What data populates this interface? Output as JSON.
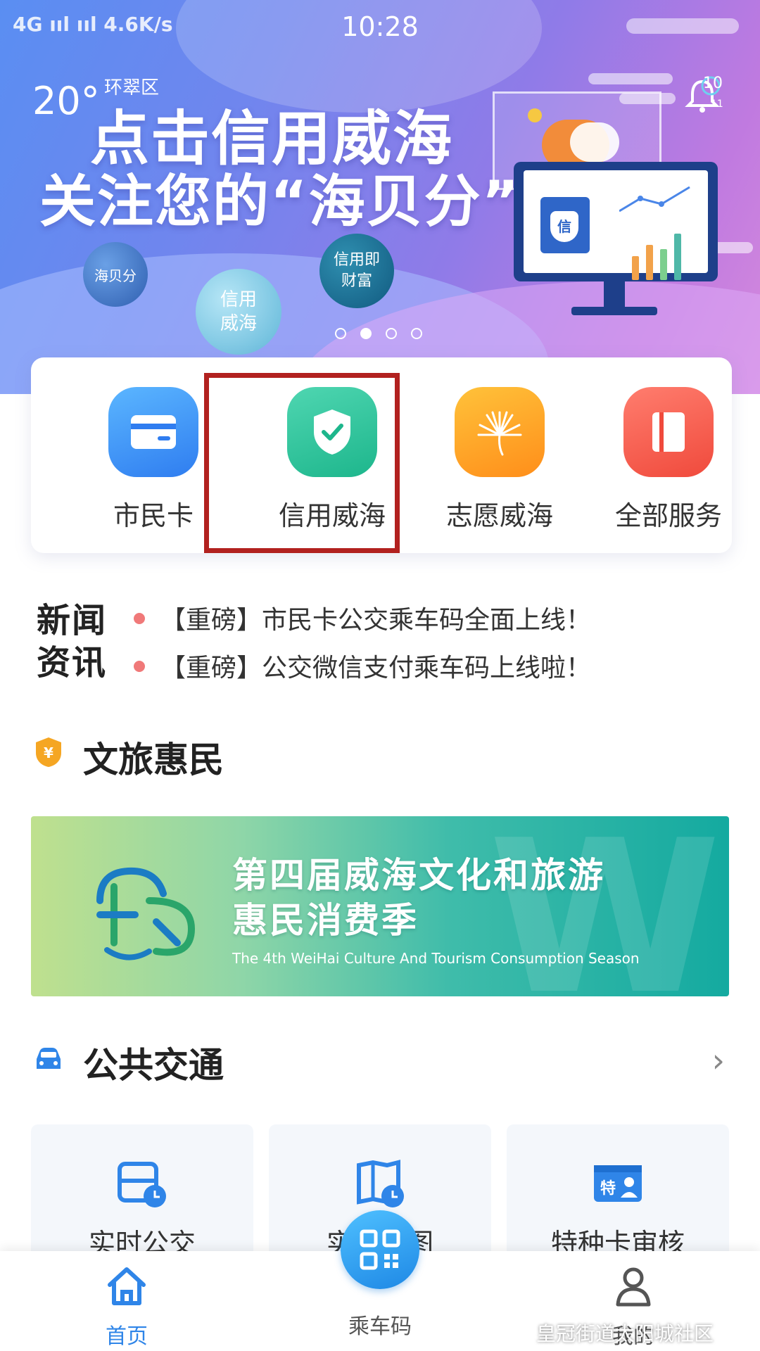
{
  "status_bar": {
    "signal": "4G ııl ııl",
    "speed": "4.6K/s",
    "time": "10:28"
  },
  "weather": {
    "temp": "20°",
    "area": "环翠区"
  },
  "notification": {
    "count": "10",
    "sub": "11"
  },
  "banner": {
    "headline_1": "点击信用威海",
    "headline_2": "关注您的“海贝分”",
    "bubble_1": "海贝分",
    "bubble_2_line1": "信用",
    "bubble_2_line2": "威海",
    "bubble_3_line1": "信用即",
    "bubble_3_line2": "财富",
    "monitor_badge": "信",
    "page_indicator": {
      "count": 4,
      "active_index": 1
    }
  },
  "services": [
    {
      "label": "市民卡",
      "icon": "card-icon",
      "color": "#2f7df0"
    },
    {
      "label": "信用威海",
      "icon": "shield-check-icon",
      "color": "#1db68c"
    },
    {
      "label": "志愿威海",
      "icon": "palm-leaf-icon",
      "color": "#ff8e1a"
    },
    {
      "label": "全部服务",
      "icon": "book-icon",
      "color": "#f04a3c"
    }
  ],
  "news": {
    "tag": "新闻资讯",
    "items": [
      "【重磅】市民卡公交乘车码全面上线！",
      "【重磅】公交微信支付乘车码上线啦！"
    ]
  },
  "culture_section": {
    "title": "文旅惠民",
    "icon": "yuan-shield-icon",
    "promo_line1": "第四届威海文化和旅游",
    "promo_line2": "惠民消费季",
    "promo_english": "The 4th WeiHai Culture And Tourism Consumption Season"
  },
  "transit_section": {
    "title": "公共交通",
    "icon": "car-icon",
    "cards": [
      {
        "label": "实时公交",
        "icon": "bus-clock-icon"
      },
      {
        "label": "实时地图",
        "icon": "map-clock-icon"
      },
      {
        "label": "特种卡审核",
        "icon": "special-card-icon"
      }
    ]
  },
  "bottom_nav": {
    "home": "首页",
    "ride_code": "乘车码",
    "mine": "我的"
  },
  "watermark": "皇冠街道太阳城社区",
  "colors": {
    "accent": "#2f85e8",
    "highlight_border": "#b2211f"
  }
}
